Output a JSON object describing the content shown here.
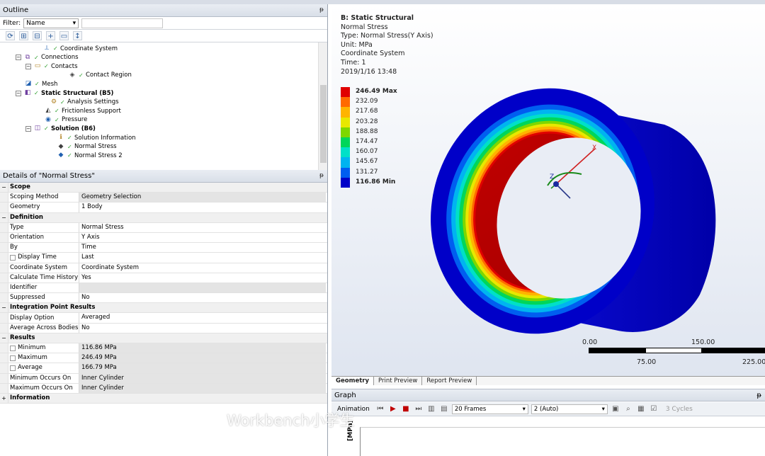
{
  "outline": {
    "title": "Outline",
    "filter_label": "Filter:",
    "filter_value": "Name",
    "tree": [
      {
        "label": "Coordinate System",
        "icon": "coordinate-icon"
      },
      {
        "label": "Connections",
        "icon": "connections-icon"
      },
      {
        "label": "Contacts",
        "icon": "folder-icon"
      },
      {
        "label": "Contact Region",
        "icon": "contact-region-icon"
      },
      {
        "label": "Mesh",
        "icon": "mesh-icon"
      },
      {
        "label": "Static Structural (B5)",
        "icon": "static-structural-icon"
      },
      {
        "label": "Analysis Settings",
        "icon": "analysis-settings-icon"
      },
      {
        "label": "Frictionless Support",
        "icon": "support-icon"
      },
      {
        "label": "Pressure",
        "icon": "pressure-icon"
      },
      {
        "label": "Solution (B6)",
        "icon": "solution-icon"
      },
      {
        "label": "Solution Information",
        "icon": "info-icon"
      },
      {
        "label": "Normal Stress",
        "icon": "result-icon"
      },
      {
        "label": "Normal Stress 2",
        "icon": "result-icon"
      }
    ]
  },
  "details": {
    "title": "Details of \"Normal Stress\"",
    "rows": [
      {
        "type": "cat",
        "label": "Scope"
      },
      {
        "label": "Scoping Method",
        "value": "Geometry Selection",
        "grey": true
      },
      {
        "label": "Geometry",
        "value": "1 Body"
      },
      {
        "type": "cat",
        "label": "Definition"
      },
      {
        "label": "Type",
        "value": "Normal Stress"
      },
      {
        "label": "Orientation",
        "value": "Y Axis"
      },
      {
        "label": "By",
        "value": "Time"
      },
      {
        "label": "Display Time",
        "value": "Last",
        "checkbox": true
      },
      {
        "label": "Coordinate System",
        "value": "Coordinate System"
      },
      {
        "label": "Calculate Time History",
        "value": "Yes"
      },
      {
        "label": "Identifier",
        "value": "",
        "grey": true
      },
      {
        "label": "Suppressed",
        "value": "No"
      },
      {
        "type": "cat",
        "label": "Integration Point Results"
      },
      {
        "label": "Display Option",
        "value": "Averaged"
      },
      {
        "label": "Average Across Bodies",
        "value": "No"
      },
      {
        "type": "cat",
        "label": "Results"
      },
      {
        "label": "Minimum",
        "value": "116.86 MPa",
        "checkbox": true,
        "grey": true
      },
      {
        "label": "Maximum",
        "value": "246.49 MPa",
        "checkbox": true,
        "grey": true
      },
      {
        "label": "Average",
        "value": "166.79 MPa",
        "checkbox": true,
        "grey": true
      },
      {
        "label": "Minimum Occurs On",
        "value": "Inner Cylinder",
        "grey": true
      },
      {
        "label": "Maximum Occurs On",
        "value": "Inner Cylinder",
        "grey": true
      },
      {
        "type": "cat",
        "label": "Information",
        "collapsed": true
      }
    ]
  },
  "viewport": {
    "title": "B: Static Structural",
    "lines": [
      "Normal Stress",
      "Type: Normal Stress(Y Axis)",
      "Unit: MPa",
      "Coordinate System",
      "Time: 1",
      "2019/1/16 13:48"
    ],
    "legend": [
      {
        "label": "246.49 Max",
        "color": "#e00000",
        "bold": true
      },
      {
        "label": "232.09",
        "color": "#ff6a00"
      },
      {
        "label": "217.68",
        "color": "#ffb400"
      },
      {
        "label": "203.28",
        "color": "#e8e800"
      },
      {
        "label": "188.88",
        "color": "#7ed700"
      },
      {
        "label": "174.47",
        "color": "#00d65a"
      },
      {
        "label": "160.07",
        "color": "#00e0c8"
      },
      {
        "label": "145.67",
        "color": "#00b4f0"
      },
      {
        "label": "131.27",
        "color": "#005ef0"
      },
      {
        "label": "116.86 Min",
        "color": "#0000c8",
        "bold": true
      }
    ],
    "scale_labels": [
      "0.00",
      "150.00",
      "75.00",
      "225.00"
    ],
    "axis_labels": {
      "x": "X",
      "z": "Z"
    },
    "tabs": [
      "Geometry",
      "Print Preview",
      "Report Preview"
    ]
  },
  "graph": {
    "title": "Graph",
    "animation_label": "Animation",
    "frames": "20 Frames",
    "time_value": "2 (Auto)",
    "cycles": "3 Cycles",
    "y_label": "[MPa]"
  },
  "watermark": "Workbench小学生"
}
